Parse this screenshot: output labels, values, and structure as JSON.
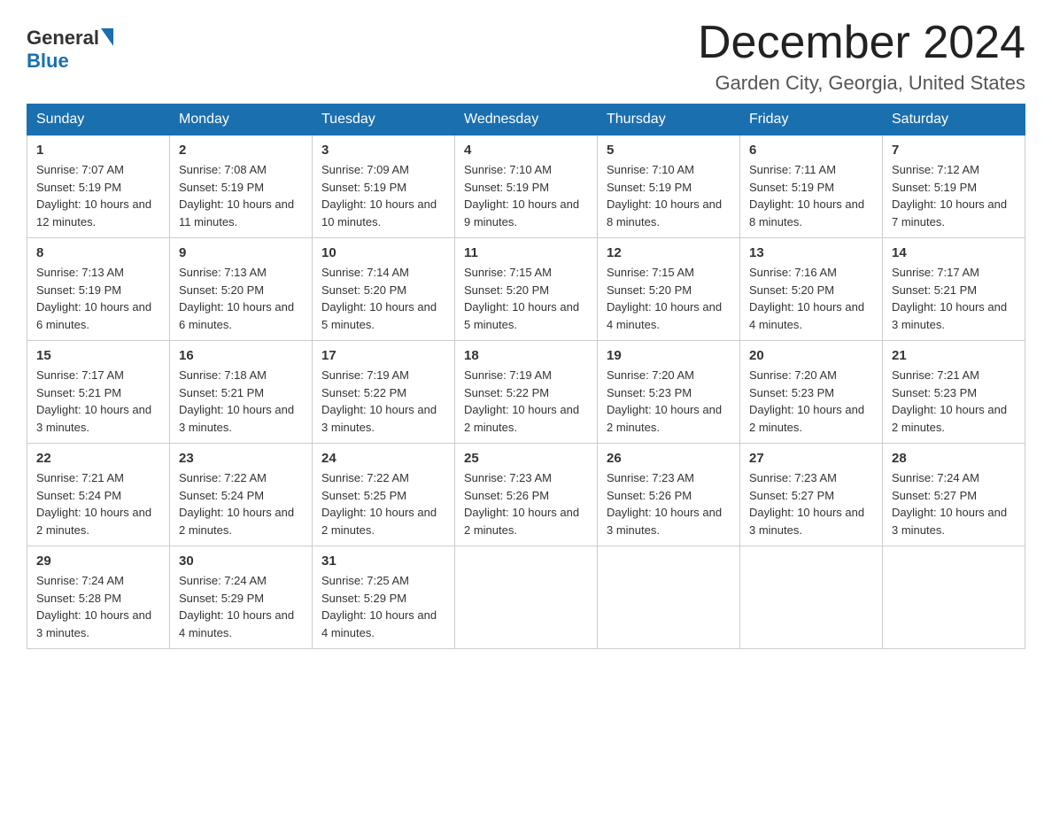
{
  "logo": {
    "text_general": "General",
    "text_blue": "Blue",
    "aria": "GeneralBlue logo"
  },
  "title": "December 2024",
  "location": "Garden City, Georgia, United States",
  "days_of_week": [
    "Sunday",
    "Monday",
    "Tuesday",
    "Wednesday",
    "Thursday",
    "Friday",
    "Saturday"
  ],
  "weeks": [
    [
      {
        "day": "1",
        "sunrise": "7:07 AM",
        "sunset": "5:19 PM",
        "daylight": "10 hours and 12 minutes."
      },
      {
        "day": "2",
        "sunrise": "7:08 AM",
        "sunset": "5:19 PM",
        "daylight": "10 hours and 11 minutes."
      },
      {
        "day": "3",
        "sunrise": "7:09 AM",
        "sunset": "5:19 PM",
        "daylight": "10 hours and 10 minutes."
      },
      {
        "day": "4",
        "sunrise": "7:10 AM",
        "sunset": "5:19 PM",
        "daylight": "10 hours and 9 minutes."
      },
      {
        "day": "5",
        "sunrise": "7:10 AM",
        "sunset": "5:19 PM",
        "daylight": "10 hours and 8 minutes."
      },
      {
        "day": "6",
        "sunrise": "7:11 AM",
        "sunset": "5:19 PM",
        "daylight": "10 hours and 8 minutes."
      },
      {
        "day": "7",
        "sunrise": "7:12 AM",
        "sunset": "5:19 PM",
        "daylight": "10 hours and 7 minutes."
      }
    ],
    [
      {
        "day": "8",
        "sunrise": "7:13 AM",
        "sunset": "5:19 PM",
        "daylight": "10 hours and 6 minutes."
      },
      {
        "day": "9",
        "sunrise": "7:13 AM",
        "sunset": "5:20 PM",
        "daylight": "10 hours and 6 minutes."
      },
      {
        "day": "10",
        "sunrise": "7:14 AM",
        "sunset": "5:20 PM",
        "daylight": "10 hours and 5 minutes."
      },
      {
        "day": "11",
        "sunrise": "7:15 AM",
        "sunset": "5:20 PM",
        "daylight": "10 hours and 5 minutes."
      },
      {
        "day": "12",
        "sunrise": "7:15 AM",
        "sunset": "5:20 PM",
        "daylight": "10 hours and 4 minutes."
      },
      {
        "day": "13",
        "sunrise": "7:16 AM",
        "sunset": "5:20 PM",
        "daylight": "10 hours and 4 minutes."
      },
      {
        "day": "14",
        "sunrise": "7:17 AM",
        "sunset": "5:21 PM",
        "daylight": "10 hours and 3 minutes."
      }
    ],
    [
      {
        "day": "15",
        "sunrise": "7:17 AM",
        "sunset": "5:21 PM",
        "daylight": "10 hours and 3 minutes."
      },
      {
        "day": "16",
        "sunrise": "7:18 AM",
        "sunset": "5:21 PM",
        "daylight": "10 hours and 3 minutes."
      },
      {
        "day": "17",
        "sunrise": "7:19 AM",
        "sunset": "5:22 PM",
        "daylight": "10 hours and 3 minutes."
      },
      {
        "day": "18",
        "sunrise": "7:19 AM",
        "sunset": "5:22 PM",
        "daylight": "10 hours and 2 minutes."
      },
      {
        "day": "19",
        "sunrise": "7:20 AM",
        "sunset": "5:23 PM",
        "daylight": "10 hours and 2 minutes."
      },
      {
        "day": "20",
        "sunrise": "7:20 AM",
        "sunset": "5:23 PM",
        "daylight": "10 hours and 2 minutes."
      },
      {
        "day": "21",
        "sunrise": "7:21 AM",
        "sunset": "5:23 PM",
        "daylight": "10 hours and 2 minutes."
      }
    ],
    [
      {
        "day": "22",
        "sunrise": "7:21 AM",
        "sunset": "5:24 PM",
        "daylight": "10 hours and 2 minutes."
      },
      {
        "day": "23",
        "sunrise": "7:22 AM",
        "sunset": "5:24 PM",
        "daylight": "10 hours and 2 minutes."
      },
      {
        "day": "24",
        "sunrise": "7:22 AM",
        "sunset": "5:25 PM",
        "daylight": "10 hours and 2 minutes."
      },
      {
        "day": "25",
        "sunrise": "7:23 AM",
        "sunset": "5:26 PM",
        "daylight": "10 hours and 2 minutes."
      },
      {
        "day": "26",
        "sunrise": "7:23 AM",
        "sunset": "5:26 PM",
        "daylight": "10 hours and 3 minutes."
      },
      {
        "day": "27",
        "sunrise": "7:23 AM",
        "sunset": "5:27 PM",
        "daylight": "10 hours and 3 minutes."
      },
      {
        "day": "28",
        "sunrise": "7:24 AM",
        "sunset": "5:27 PM",
        "daylight": "10 hours and 3 minutes."
      }
    ],
    [
      {
        "day": "29",
        "sunrise": "7:24 AM",
        "sunset": "5:28 PM",
        "daylight": "10 hours and 3 minutes."
      },
      {
        "day": "30",
        "sunrise": "7:24 AM",
        "sunset": "5:29 PM",
        "daylight": "10 hours and 4 minutes."
      },
      {
        "day": "31",
        "sunrise": "7:25 AM",
        "sunset": "5:29 PM",
        "daylight": "10 hours and 4 minutes."
      },
      null,
      null,
      null,
      null
    ]
  ],
  "labels": {
    "sunrise": "Sunrise:",
    "sunset": "Sunset:",
    "daylight": "Daylight:"
  }
}
